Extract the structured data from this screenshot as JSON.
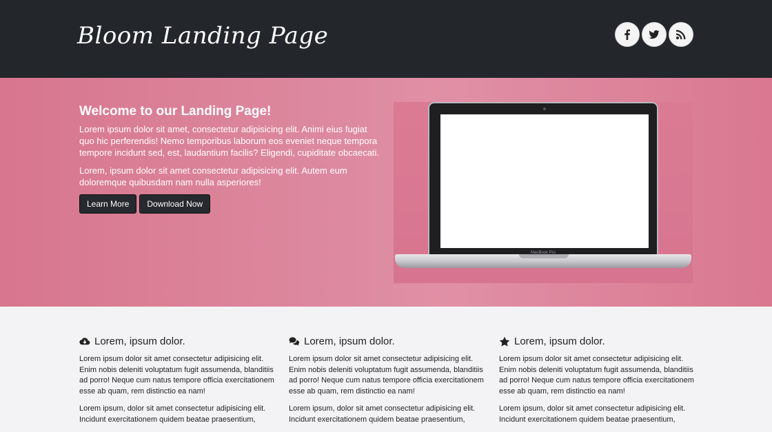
{
  "header": {
    "brand": "Bloom Landing Page",
    "social": [
      {
        "icon": "facebook-icon"
      },
      {
        "icon": "twitter-icon"
      },
      {
        "icon": "rss-icon"
      }
    ]
  },
  "hero": {
    "title": "Welcome to our Landing Page!",
    "paragraph1": "Lorem ipsum dolor sit amet, consectetur adipisicing elit. Animi eius fugiat quo hic perferendis! Nemo temporibus laborum eos eveniet neque tempora tempore incidunt sed, est, laudantium facilis? Eligendi, cupiditate obcaecati.",
    "paragraph2": "Lorem, ipsum dolor sit amet consectetur adipisicing elit. Autem eum doloremque quibusdam nam nulla asperiores!",
    "learn_more": "Learn More",
    "download_now": "Download Now",
    "laptop_label": "MacBook Pro"
  },
  "features": [
    {
      "icon": "cloud-download-icon",
      "title": "Lorem, ipsum dolor.",
      "p1": "Lorem ipsum dolor sit amet consectetur adipisicing elit. Enim nobis deleniti voluptatum fugit assumenda, blanditiis ad porro! Neque cum natus tempore officia exercitationem esse ab quam, rem distinctio ea nam!",
      "p2": "Lorem ipsum, dolor sit amet consectetur adipisicing elit. Incidunt exercitationem quidem beatae praesentium,"
    },
    {
      "icon": "comments-icon",
      "title": "Lorem, ipsum dolor.",
      "p1": "Lorem ipsum dolor sit amet consectetur adipisicing elit. Enim nobis deleniti voluptatum fugit assumenda, blanditiis ad porro! Neque cum natus tempore officia exercitationem esse ab quam, rem distinctio ea nam!",
      "p2": "Lorem ipsum, dolor sit amet consectetur adipisicing elit. Incidunt exercitationem quidem beatae praesentium,"
    },
    {
      "icon": "star-icon",
      "title": "Lorem, ipsum dolor.",
      "p1": "Lorem ipsum dolor sit amet consectetur adipisicing elit. Enim nobis deleniti voluptatum fugit assumenda, blanditiis ad porro! Neque cum natus tempore officia exercitationem esse ab quam, rem distinctio ea nam!",
      "p2": "Lorem ipsum, dolor sit amet consectetur adipisicing elit. Incidunt exercitationem quidem beatae praesentium,"
    }
  ],
  "colors": {
    "header_bg": "#23262b",
    "hero_bg": "#d97890",
    "button_bg": "#26292e",
    "features_bg": "#f3f3f5"
  }
}
